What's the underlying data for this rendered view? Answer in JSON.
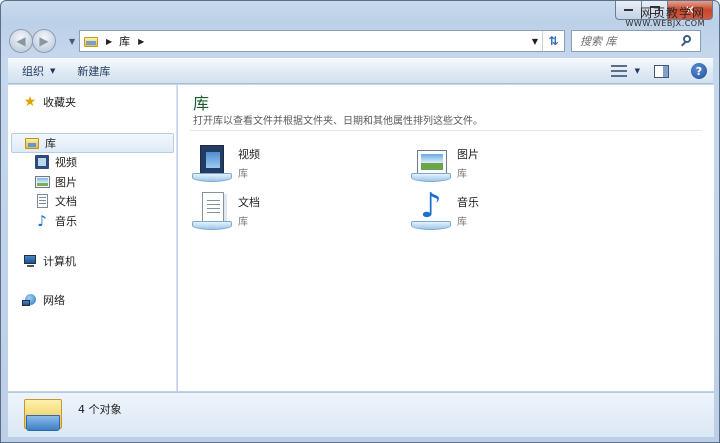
{
  "watermark": {
    "line1": "网页教学网",
    "line2": "WWW.WEBJX.COM"
  },
  "address": {
    "crumb": "库"
  },
  "search": {
    "placeholder": "搜索 库"
  },
  "toolbar": {
    "organize": "组织",
    "new_library": "新建库"
  },
  "sidebar": {
    "favorites": "收藏夹",
    "libraries": "库",
    "library_items": [
      "视频",
      "图片",
      "文档",
      "音乐"
    ],
    "computer": "计算机",
    "network": "网络"
  },
  "content": {
    "title": "库",
    "description": "打开库以查看文件并根据文件夹、日期和其他属性排列这些文件。",
    "tiles": [
      {
        "name": "视频",
        "sub": "库",
        "icon": "video-library-icon"
      },
      {
        "name": "图片",
        "sub": "库",
        "icon": "pictures-library-icon"
      },
      {
        "name": "文档",
        "sub": "库",
        "icon": "documents-library-icon"
      },
      {
        "name": "音乐",
        "sub": "库",
        "icon": "music-library-icon"
      }
    ]
  },
  "status": {
    "count": "4 个对象"
  },
  "colors": {
    "title_green": "#1d5a2e",
    "chrome_blue": "#c5d8ee",
    "selection": "#dfeaf7"
  }
}
